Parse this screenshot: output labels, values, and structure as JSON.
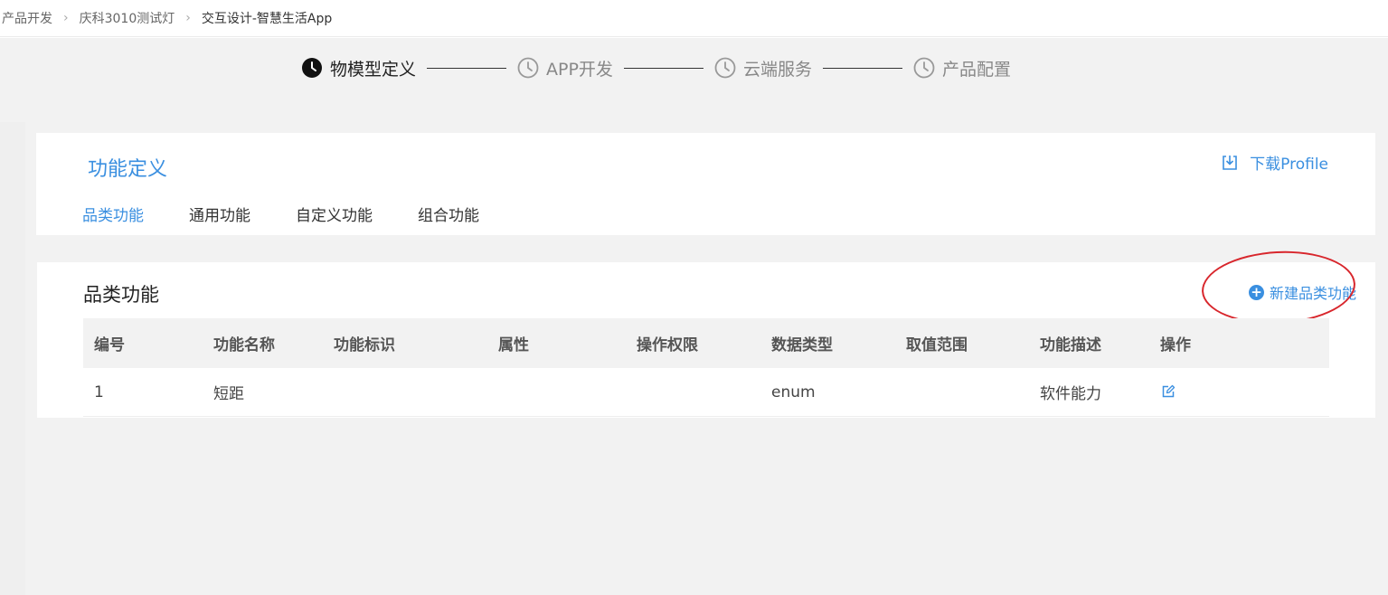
{
  "breadcrumb": {
    "items": [
      "产品开发",
      "庆科3010测试灯",
      "交互设计-智慧生活App"
    ],
    "separator": ">"
  },
  "steps": [
    {
      "label": "物模型定义",
      "active": true
    },
    {
      "label": "APP开发",
      "active": false
    },
    {
      "label": "云端服务",
      "active": false
    },
    {
      "label": "产品配置",
      "active": false
    }
  ],
  "header": {
    "title": "功能定义",
    "download_label": "下载Profile",
    "tabs": [
      "品类功能",
      "通用功能",
      "自定义功能",
      "组合功能"
    ],
    "active_tab": "品类功能"
  },
  "list": {
    "title": "品类功能",
    "new_button_label": "新建品类功能",
    "columns": [
      "编号",
      "功能名称",
      "功能标识",
      "属性",
      "操作权限",
      "数据类型",
      "取值范围",
      "功能描述",
      "操作"
    ],
    "rows": [
      {
        "id": "1",
        "name": "短距",
        "identifier": "",
        "attribute": "",
        "permission": "",
        "data_type": "enum",
        "range": "",
        "description": "软件能力"
      }
    ]
  },
  "colors": {
    "accent": "#3a8fe0",
    "highlight_ring": "#d8262c"
  }
}
